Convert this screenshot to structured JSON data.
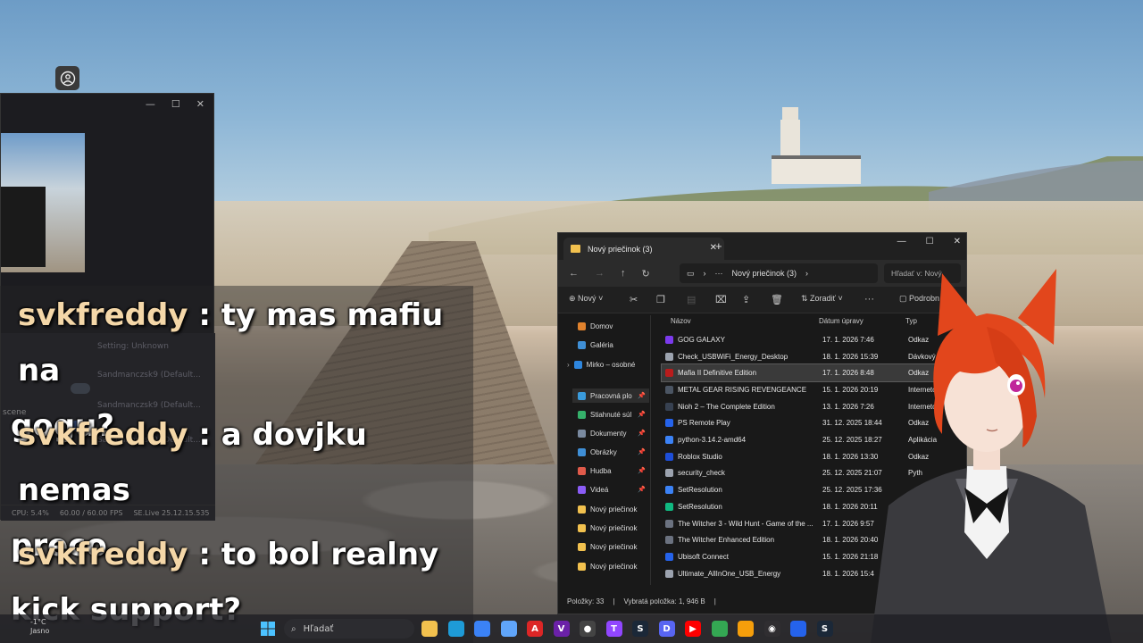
{
  "obs": {
    "sources": [
      {
        "label": "Setting: Unknown"
      },
      {
        "label": "Sandmanczsk9 (Default..."
      },
      {
        "label": "Sandmanczsk9 (Default..."
      },
      {
        "label": "Sandmanczsk9 (Default..."
      }
    ],
    "scene_label": "scene",
    "status_cpu": "CPU: 5.4%",
    "status_fps": "60.00 / 60.00 FPS",
    "status_version": "SE.Live 25.12.15.535"
  },
  "chat": {
    "messages": [
      {
        "user": "svkfreddy",
        "sep": " : ",
        "line1": "ty mas mafiu na",
        "line2": "gogu?"
      },
      {
        "user": "svkfreddy",
        "sep": " : ",
        "line1": "a dovjku nemas",
        "line2": "preco"
      },
      {
        "user": "svkfreddy",
        "sep": " : ",
        "line1": "to bol realny",
        "line2": "kick support?"
      }
    ]
  },
  "explorer": {
    "tab_title": "Nový priečinok (3)",
    "tab_close": "✕",
    "new_tab": "+",
    "window_buttons": {
      "minimize": "—",
      "maximize": "☐",
      "close": "✕"
    },
    "breadcrumb_more": "···",
    "breadcrumb_folder": "Nový priečinok (3)",
    "search_placeholder": "Hľadať v: Nový",
    "toolbar": {
      "new_label": "Nový",
      "sort_label": "Zoradiť",
      "details_label": "Podrobn"
    },
    "sidebar": [
      {
        "label": "Domov",
        "color": "#e0822d"
      },
      {
        "label": "Galéria",
        "color": "#3f8fd6"
      },
      {
        "label": "Mirko – osobné",
        "color": "#2e86de"
      },
      {
        "label": "Pracovná plo",
        "color": "#3a9bdc"
      },
      {
        "label": "Stiahnuté súl",
        "color": "#35b06a"
      },
      {
        "label": "Dokumenty",
        "color": "#7a8aa0"
      },
      {
        "label": "Obrázky",
        "color": "#3f8fd6"
      },
      {
        "label": "Hudba",
        "color": "#e05a4a"
      },
      {
        "label": "Videá",
        "color": "#8b5cf6"
      },
      {
        "label": "Nový priečinok",
        "color": "#f2c14e"
      },
      {
        "label": "Nový priečinok",
        "color": "#f2c14e"
      },
      {
        "label": "Nový priečinok",
        "color": "#f2c14e"
      },
      {
        "label": "Nový priečinok",
        "color": "#f2c14e"
      }
    ],
    "columns": {
      "name": "Názov",
      "date": "Dátum úpravy",
      "type": "Typ"
    },
    "files": [
      {
        "name": "GOG GALAXY",
        "date": "17. 1. 2026 7:46",
        "type": "Odkaz",
        "color": "#7c3aed"
      },
      {
        "name": "Check_USBWiFi_Energy_Desktop",
        "date": "18. 1. 2026 15:39",
        "type": "Dávkový súb",
        "color": "#9ca3af"
      },
      {
        "name": "Mafia II Definitive Edition",
        "date": "17. 1. 2026 8:48",
        "type": "Odkaz",
        "color": "#b91c1c"
      },
      {
        "name": "METAL GEAR RISING REVENGEANCE",
        "date": "15. 1. 2026 20:19",
        "type": "Internetový",
        "color": "#4b5563"
      },
      {
        "name": "Nioh 2 – The Complete Edition",
        "date": "13. 1. 2026 7:26",
        "type": "Internetový o",
        "color": "#374151"
      },
      {
        "name": "PS Remote Play",
        "date": "31. 12. 2025 18:44",
        "type": "Odkaz",
        "color": "#2563eb"
      },
      {
        "name": "python-3.14.2-amd64",
        "date": "25. 12. 2025 18:27",
        "type": "Aplikácia",
        "color": "#3b82f6"
      },
      {
        "name": "Roblox Studio",
        "date": "18. 1. 2026 13:30",
        "type": "Odkaz",
        "color": "#1d4ed8"
      },
      {
        "name": "security_check",
        "date": "25. 12. 2025 21:07",
        "type": "Pyth",
        "color": "#9ca3af"
      },
      {
        "name": "SetResolution",
        "date": "25. 12. 2025 17:36",
        "type": "",
        "color": "#3b82f6"
      },
      {
        "name": "SetResolution",
        "date": "18. 1. 2026 20:11",
        "type": "",
        "color": "#10b981"
      },
      {
        "name": "The Witcher 3 - Wild Hunt - Game of the ...",
        "date": "17. 1. 2026 9:57",
        "type": "",
        "color": "#6b7280"
      },
      {
        "name": "The Witcher Enhanced Edition",
        "date": "18. 1. 2026 20:40",
        "type": "",
        "color": "#6b7280"
      },
      {
        "name": "Ubisoft Connect",
        "date": "15. 1. 2026 21:18",
        "type": "",
        "color": "#2563eb"
      },
      {
        "name": "Ultimate_AllInOne_USB_Energy",
        "date": "18. 1. 2026 15:4",
        "type": "",
        "color": "#9ca3af"
      }
    ],
    "status_count": "Položky: 33",
    "status_selected": "Vybratá položka: 1, 946 B"
  },
  "taskbar": {
    "weather_line1": "-1°C",
    "weather_line2": "Jasno",
    "search_label": "Hľadať",
    "apps": [
      {
        "name": "file-explorer",
        "color": "#f2c14e",
        "glyph": ""
      },
      {
        "name": "edge",
        "color": "#1e9bd7",
        "glyph": ""
      },
      {
        "name": "store",
        "color": "#3b82f6",
        "glyph": ""
      },
      {
        "name": "app-4",
        "color": "#60a5fa",
        "glyph": ""
      },
      {
        "name": "amd",
        "color": "#dc2626",
        "glyph": "A"
      },
      {
        "name": "vs",
        "color": "#6b21a8",
        "glyph": "V"
      },
      {
        "name": "github",
        "color": "#444",
        "glyph": "●"
      },
      {
        "name": "twitch",
        "color": "#9146ff",
        "glyph": "T"
      },
      {
        "name": "steam",
        "color": "#1b2838",
        "glyph": "S"
      },
      {
        "name": "discord",
        "color": "#5865f2",
        "glyph": "D"
      },
      {
        "name": "youtube",
        "color": "#ff0000",
        "glyph": "▶"
      },
      {
        "name": "chrome",
        "color": "#34a853",
        "glyph": ""
      },
      {
        "name": "app-13",
        "color": "#f59e0b",
        "glyph": ""
      },
      {
        "name": "obs",
        "color": "#302e31",
        "glyph": "◉"
      },
      {
        "name": "app-15",
        "color": "#2563eb",
        "glyph": ""
      },
      {
        "name": "steam-2",
        "color": "#1b2838",
        "glyph": "S"
      }
    ]
  }
}
